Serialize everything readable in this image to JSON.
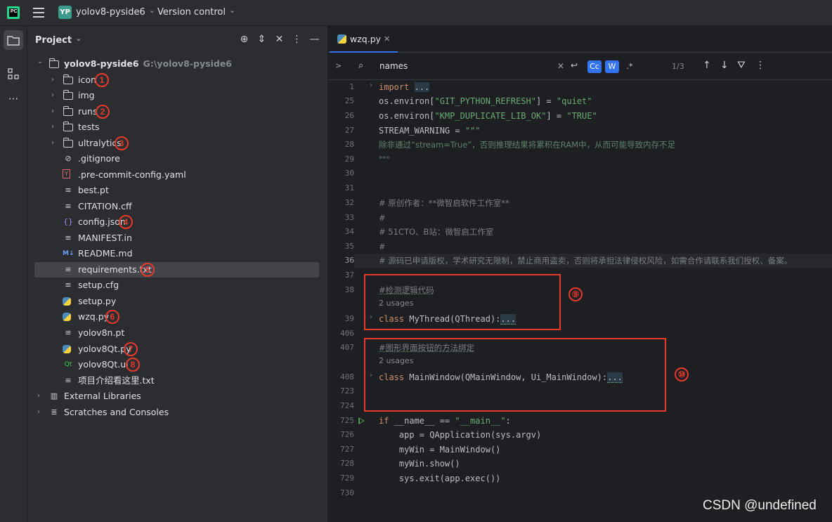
{
  "titlebar": {
    "logo_text": "PC",
    "project_badge": "YP",
    "project_name": "yolov8-pyside6",
    "vcs_label": "Version control"
  },
  "project_panel": {
    "title": "Project",
    "tree": [
      {
        "label": "yolov8-pyside6",
        "hint": "G:\\yolov8-pyside6",
        "icon": "folder-icon",
        "expanded": true
      },
      {
        "label": "icon",
        "icon": "folder-icon",
        "badge": "1"
      },
      {
        "label": "img",
        "icon": "folder-icon"
      },
      {
        "label": "runs",
        "icon": "folder-icon",
        "badge": "2"
      },
      {
        "label": "tests",
        "icon": "folder-icon"
      },
      {
        "label": "ultralytics",
        "icon": "package-folder-icon",
        "badge": "3"
      },
      {
        "label": ".gitignore",
        "icon": "ignore-file-icon"
      },
      {
        "label": ".pre-commit-config.yaml",
        "icon": "yaml-file-icon"
      },
      {
        "label": "best.pt",
        "icon": "text-file-icon"
      },
      {
        "label": "CITATION.cff",
        "icon": "text-file-icon"
      },
      {
        "label": "config.json",
        "icon": "json-file-icon",
        "badge": "4"
      },
      {
        "label": "MANIFEST.in",
        "icon": "text-file-icon"
      },
      {
        "label": "README.md",
        "icon": "markdown-file-icon"
      },
      {
        "label": "requirements.txt",
        "icon": "text-file-icon",
        "badge": "5",
        "selected": true
      },
      {
        "label": "setup.cfg",
        "icon": "text-file-icon"
      },
      {
        "label": "setup.py",
        "icon": "python-file-icon"
      },
      {
        "label": "wzq.py",
        "icon": "python-file-icon",
        "badge": "6"
      },
      {
        "label": "yolov8n.pt",
        "icon": "text-file-icon"
      },
      {
        "label": "yolov8Qt.py",
        "icon": "python-file-icon",
        "badge": "7"
      },
      {
        "label": "yolov8Qt.ui",
        "icon": "qt-ui-file-icon",
        "badge": "8"
      },
      {
        "label": "项目介绍看这里.txt",
        "icon": "text-file-icon"
      },
      {
        "label": "External Libraries",
        "icon": "library-icon"
      },
      {
        "label": "Scratches and Consoles",
        "icon": "scratches-icon"
      }
    ]
  },
  "editor": {
    "tab_label": "wzq.py",
    "find": {
      "query": "names",
      "match_case": "Cc",
      "words": "W",
      "regex": ".*",
      "count": "1/3"
    },
    "lines": [
      {
        "n": "1",
        "text": "import ..."
      },
      {
        "n": "25",
        "a": "os.environ[",
        "s": "\"GIT_PYTHON_REFRESH\"",
        "b": "] = ",
        "s2": "\"quiet\""
      },
      {
        "n": "26",
        "a": "os.environ[",
        "s": "\"KMP_DUPLICATE_LIB_OK\"",
        "b": "] = ",
        "s2": "\"TRUE\""
      },
      {
        "n": "27",
        "a": "STREAM_WARNING = ",
        "s": "\"\"\""
      },
      {
        "n": "28",
        "doc": "除非通过“stream=True”，否则推理结果将累积在RAM中，从而可能导致内存不足"
      },
      {
        "n": "29",
        "doc": "\"\"\""
      },
      {
        "n": "30"
      },
      {
        "n": "31"
      },
      {
        "n": "32",
        "cm": "# 原创作者：**微智启软件工作室**"
      },
      {
        "n": "33",
        "cm": "#"
      },
      {
        "n": "34",
        "cm": "# 51CTO、B站：微智启工作室"
      },
      {
        "n": "35",
        "cm": "#"
      },
      {
        "n": "36",
        "cm": "# 源码已申请版权，学术研究无限制，禁止商用盗卖，否则将承担法律侵权风险，如需合作请联系我们授权、备案。"
      },
      {
        "n": "37"
      },
      {
        "n": "38",
        "cm": "#检测逻辑代码"
      },
      {
        "n": "39",
        "kw": "class ",
        "text": "MyThread(QThread):",
        "dots": "..."
      },
      {
        "n": "406"
      },
      {
        "n": "407",
        "cm": "#图形界面按钮的方法绑定"
      },
      {
        "n": "408",
        "kw": "class ",
        "text": "MainWindow(QMainWindow, Ui_MainWindow):",
        "dots": "..."
      },
      {
        "n": "723"
      },
      {
        "n": "724"
      },
      {
        "n": "725",
        "kw": "if ",
        "text": "__name__ == ",
        "s": "\"__main__\"",
        "b": ":"
      },
      {
        "n": "726",
        "text": "    app = QApplication(sys.argv)"
      },
      {
        "n": "727",
        "text": "    myWin = MainWindow()"
      },
      {
        "n": "728",
        "text": "    myWin.show()"
      },
      {
        "n": "729",
        "text": "    sys.exit(app.exec())"
      },
      {
        "n": "730"
      }
    ],
    "usages_label": "2 usages",
    "annotations": [
      "⑨",
      "⑩"
    ]
  },
  "watermark": "CSDN @undefined"
}
